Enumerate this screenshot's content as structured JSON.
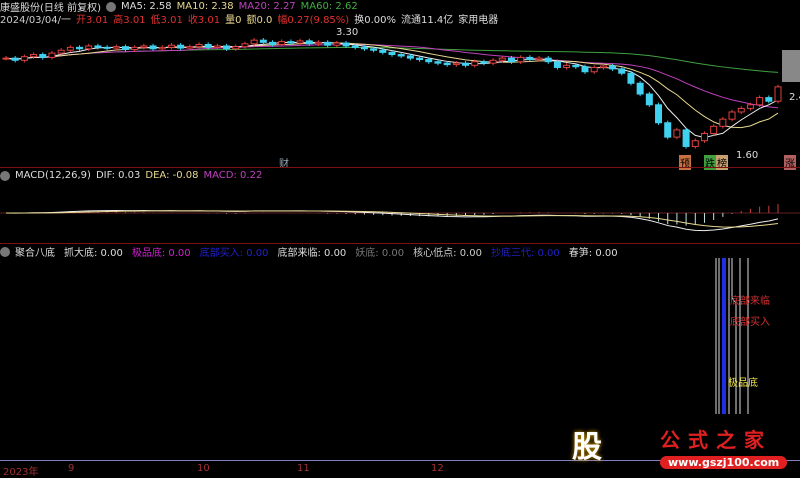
{
  "header": {
    "title": "康盛股份(日线 前复权)",
    "ma5": "MA5: 2.58",
    "ma10": "MA10: 2.38",
    "ma20": "MA20: 2.27",
    "ma60": "MA60: 2.62"
  },
  "quote": {
    "date": "2024/03/04/一",
    "open": "开3.01",
    "high": "高3.01",
    "low": "低3.01",
    "close": "收3.01",
    "vol": "量0",
    "amount": "额0.0",
    "change": "幅0.27(9.85%)",
    "turnover": "换0.00%",
    "float": "流通11.4亿",
    "industry": "家用电器"
  },
  "price_labels": {
    "high": "3.30",
    "low": "1.60",
    "right": "2.4"
  },
  "markers": {
    "cai": "财",
    "yu": "预",
    "die": "跌",
    "bang": "榜",
    "zhang": "涨"
  },
  "macd": {
    "title": "MACD(12,26,9)",
    "dif": "DIF: 0.03",
    "dea": "DEA: -0.08",
    "macd": "MACD: 0.22"
  },
  "indicator": {
    "title": "聚合八底",
    "items": [
      {
        "label": "抓大底: 0.00",
        "color": "#dddddd"
      },
      {
        "label": "极品底: 0.00",
        "color": "#d020d0"
      },
      {
        "label": "底部买入: 0.00",
        "color": "#2020d0"
      },
      {
        "label": "底部来临: 0.00",
        "color": "#dddddd"
      },
      {
        "label": "妖底: 0.00",
        "color": "#777777"
      },
      {
        "label": "核心低点: 0.00",
        "color": "#cccccc"
      },
      {
        "label": "抄底三代: 0.00",
        "color": "#2020c0"
      },
      {
        "label": "春笋: 0.00",
        "color": "#dddddd"
      }
    ],
    "signals": {
      "a": "底部来临",
      "b": "底部买入",
      "c": "极品底"
    }
  },
  "xaxis": [
    "2023年",
    "9",
    "10",
    "11",
    "12"
  ],
  "logo": {
    "char": "股",
    "name": "公式之家",
    "url": "www.gszj100.com"
  },
  "kline": {
    "closes": [
      2.95,
      2.92,
      2.97,
      3.0,
      2.96,
      3.02,
      3.06,
      3.1,
      3.08,
      3.12,
      3.1,
      3.09,
      3.11,
      3.07,
      3.1,
      3.12,
      3.08,
      3.1,
      3.13,
      3.09,
      3.11,
      3.14,
      3.1,
      3.12,
      3.08,
      3.11,
      3.15,
      3.2,
      3.17,
      3.14,
      3.18,
      3.16,
      3.19,
      3.15,
      3.17,
      3.13,
      3.16,
      3.12,
      3.1,
      3.08,
      3.06,
      3.03,
      3.0,
      2.98,
      2.95,
      2.93,
      2.9,
      2.88,
      2.86,
      2.88,
      2.85,
      2.9,
      2.88,
      2.92,
      2.95,
      2.9,
      2.96,
      2.93,
      2.95,
      2.9,
      2.82,
      2.85,
      2.83,
      2.76,
      2.82,
      2.84,
      2.8,
      2.74,
      2.6,
      2.45,
      2.3,
      2.05,
      1.85,
      1.95,
      1.72,
      1.8,
      1.9,
      2.0,
      2.1,
      2.2,
      2.25,
      2.3,
      2.4,
      2.35,
      2.55
    ]
  }
}
